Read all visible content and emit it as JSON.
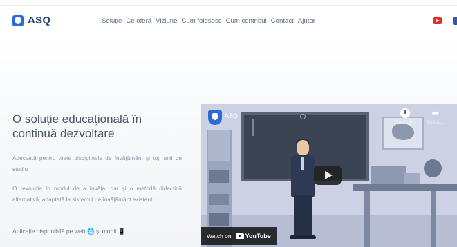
{
  "brand": {
    "name": "ASQ",
    "color": "#2b6cd4"
  },
  "nav": {
    "items": [
      {
        "label": "Soluție"
      },
      {
        "label": "Ce oferă"
      },
      {
        "label": "Viziune"
      },
      {
        "label": "Cum folosesc"
      },
      {
        "label": "Cum contribui"
      },
      {
        "label": "Contact"
      },
      {
        "label": "Ajutor"
      }
    ]
  },
  "social": {
    "youtube_icon": "youtube-icon",
    "facebook_icon": "facebook-icon",
    "youtube_color": "#e52d27",
    "facebook_color": "#3b5998"
  },
  "hero": {
    "headline": "O soluție educațională în continuă dezvoltare",
    "paragraph1": "Adecvată pentru toate disciplinele de învățământ și toți anii de studiu",
    "paragraph2": "O revoluție în modul de a învăța, dar și o metodă didactică alternativă, adaptată la sistemul de învățământ existent",
    "availability": "Aplicație disponibilă pe web 🌐 și mobil 📱"
  },
  "video": {
    "channel_title": "ASQ",
    "watch_later_label": "Vizionați...",
    "share_label": "Distrib...",
    "watch_on_label": "Watch on",
    "youtube_wordmark": "YouTube",
    "play_icon": "play-icon"
  }
}
